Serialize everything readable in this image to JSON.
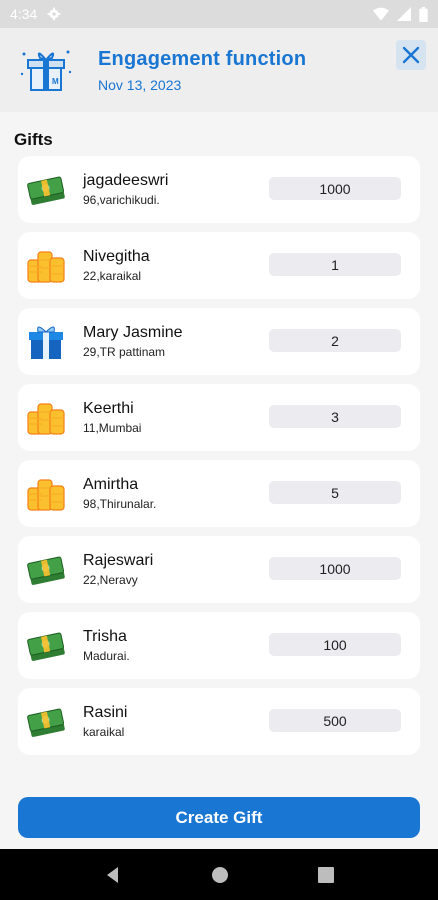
{
  "status_bar": {
    "time": "4:34"
  },
  "header": {
    "title": "Engagement function",
    "date": "Nov 13, 2023"
  },
  "section_title": "Gifts",
  "gifts": [
    {
      "name": "jagadeeswri",
      "address": "96,varichikudi.",
      "amount": "1000",
      "icon": "cash-icon"
    },
    {
      "name": "Nivegitha",
      "address": "22,karaikal",
      "amount": "1",
      "icon": "gold-coins-icon"
    },
    {
      "name": "Mary Jasmine",
      "address": "29,TR pattinam",
      "amount": "2",
      "icon": "gift-box-icon"
    },
    {
      "name": "Keerthi",
      "address": "11,Mumbai",
      "amount": "3",
      "icon": "gold-coins-icon"
    },
    {
      "name": "Amirtha",
      "address": "98,Thirunalar.",
      "amount": "5",
      "icon": "gold-coins-icon"
    },
    {
      "name": "Rajeswari",
      "address": "22,Neravy",
      "amount": "1000",
      "icon": "cash-icon"
    },
    {
      "name": "Trisha",
      "address": "Madurai.",
      "amount": "100",
      "icon": "cash-icon"
    },
    {
      "name": "Rasini",
      "address": "karaikal",
      "amount": "500",
      "icon": "cash-icon"
    }
  ],
  "create_button_label": "Create Gift",
  "colors": {
    "accent": "#1976d2",
    "status_bar": "#dcdcdc",
    "header_bg": "#eeeeee"
  }
}
